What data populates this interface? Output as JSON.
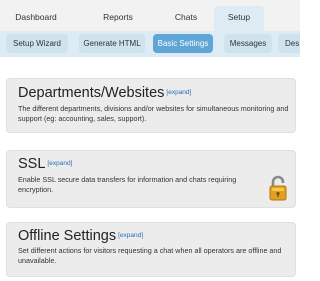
{
  "top_tabs": [
    "Dashboard",
    "Reports",
    "Chats",
    "Setup"
  ],
  "sub_nav": [
    "Setup Wizard",
    "Generate HTML",
    "Basic Settings",
    "Messages",
    "Des"
  ],
  "panels": [
    {
      "title": "Departments/Websites",
      "expand": "[expand]",
      "desc": "The different departments, divisions and/or websites for simultaneous monitoring and support (eg: accounting, sales, support)."
    },
    {
      "title": "SSL",
      "expand": "[expand]",
      "desc": "Enable SSL secure data transfers for information and chats requiring encryption."
    },
    {
      "title": "Offline Settings",
      "expand": "[expand]",
      "desc": "Set different actions for visitors requesting a chat when all operators are offline and unavailable."
    }
  ],
  "colors": {
    "active_tab_bg": "#dcebf4",
    "active_button": "#5fa5d6",
    "link": "#2a6eb5",
    "lock": "#e0a020"
  }
}
